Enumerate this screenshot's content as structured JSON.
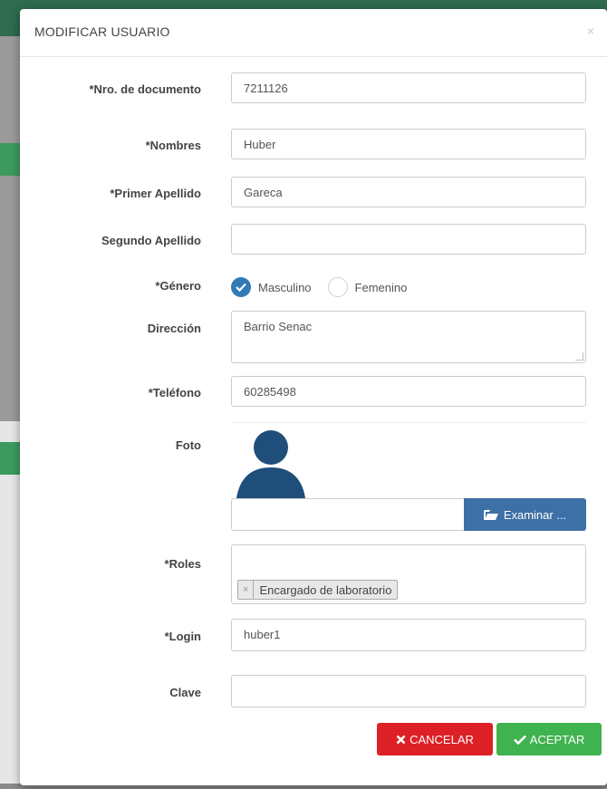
{
  "modal": {
    "title": "MODIFICAR USUARIO",
    "close": "×"
  },
  "fields": {
    "documento": {
      "label": "*Nro. de documento",
      "value": "7211126"
    },
    "nombres": {
      "label": "*Nombres",
      "value": "Huber"
    },
    "primer_apellido": {
      "label": "*Primer Apellido",
      "value": "Gareca"
    },
    "segundo_apellido": {
      "label": "Segundo Apellido",
      "value": ""
    },
    "genero": {
      "label": "*Género",
      "options": [
        "Masculino",
        "Femenino"
      ],
      "selected": "Masculino"
    },
    "direccion": {
      "label": "Dirección",
      "value": "Barrio Senac"
    },
    "telefono": {
      "label": "*Teléfono",
      "value": "60285498"
    },
    "foto": {
      "label": "Foto",
      "browse_label": "Examinar ..."
    },
    "roles": {
      "label": "*Roles",
      "selected_tag": "Encargado de laboratorio",
      "tag_remove": "×"
    },
    "login": {
      "label": "*Login",
      "value": "huber1"
    },
    "clave": {
      "label": "Clave",
      "value": ""
    }
  },
  "buttons": {
    "cancel": "CANCELAR",
    "accept": "ACEPTAR"
  },
  "colors": {
    "primary": "#337ab7",
    "danger": "#dd1f26",
    "success": "#3fb34f",
    "avatar": "#1f4e7a"
  }
}
